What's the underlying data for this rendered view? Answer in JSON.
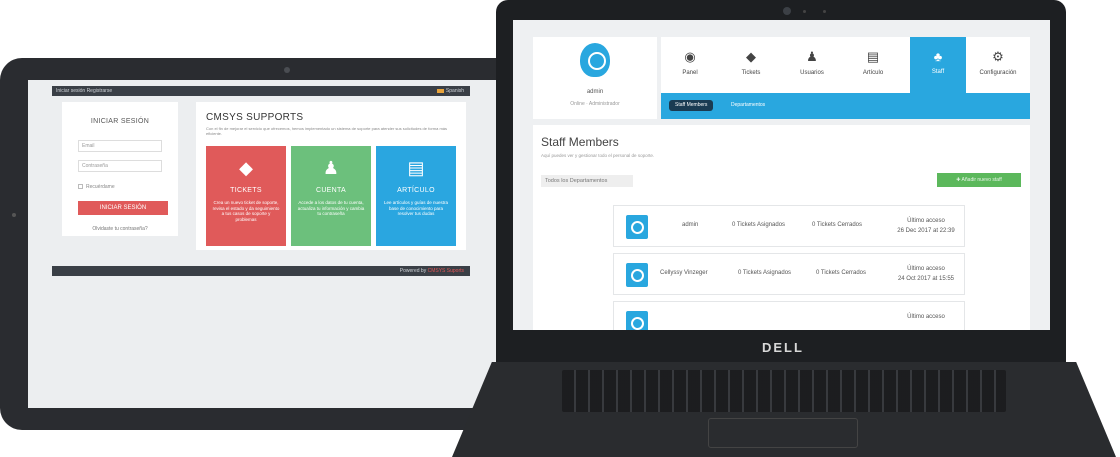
{
  "tablet": {
    "topbar": {
      "links": "Iniciar sesión   Registrarse",
      "language": "Spanish"
    },
    "login": {
      "title": "INICIAR SESIÓN",
      "email_placeholder": "Email",
      "password_placeholder": "Contraseña",
      "remember": "Recuérdame",
      "button": "INICIAR SESIÓN",
      "forgot": "Olvidaste tu contraseña?"
    },
    "main": {
      "title": "CMSYS SUPPORTS",
      "description": "Con el fin de mejorar el servicio que ofrecemos, hemos implementado un sistema de soporte para atender sus solicitudes de forma más eficiente.",
      "tiles": [
        {
          "title": "TICKETS",
          "text": "Crea un nuevo ticket de soporte, revisa el estado y da seguimiento a tus casos de soporte y problemas",
          "color": "#e05a5a"
        },
        {
          "title": "CUENTA",
          "text": "Accede a los datos de tu cuenta, actualiza tu información y cambia tu contraseña",
          "color": "#6cc07c"
        },
        {
          "title": "ARTÍCULO",
          "text": "Lee artículos y guías de nuestra base de conocimiento para resolver tus dudas",
          "color": "#2aa6e0"
        }
      ]
    },
    "footer": {
      "prefix": "Powered by ",
      "brand": "CMSYS Suports"
    }
  },
  "laptop": {
    "brand": "DELL",
    "profile": {
      "name": "admin",
      "status": "Online · Administrador"
    },
    "nav": [
      {
        "label": "Panel",
        "icon": "dashboard-icon",
        "glyph": "◉"
      },
      {
        "label": "Tickets",
        "icon": "ticket-icon",
        "glyph": "◆"
      },
      {
        "label": "Usuarios",
        "icon": "user-icon",
        "glyph": "♟"
      },
      {
        "label": "Artículo",
        "icon": "article-icon",
        "glyph": "▤"
      },
      {
        "label": "Staff",
        "icon": "staff-icon",
        "glyph": "♣"
      },
      {
        "label": "Configuración",
        "icon": "gear-icon",
        "glyph": "⚙"
      }
    ],
    "subtabs": [
      "Staff Members",
      "Departamentos"
    ],
    "panel": {
      "title": "Staff Members",
      "subtitle": "Aquí puedes ver y gestionar todo el personal de soporte.",
      "dept_button": "Todos los Departamentos",
      "add_button": "Añadir nuevo staff"
    },
    "staff": [
      {
        "name": "admin",
        "assigned": "0 Tickets Asignados",
        "closed": "0 Tickets Cerrados",
        "last_label": "Último acceso",
        "last_date": "26 Dec 2017 at 22:39"
      },
      {
        "name": "Cellyssy Vinzeger",
        "assigned": "0 Tickets Asignados",
        "closed": "0 Tickets Cerrados",
        "last_label": "Último acceso",
        "last_date": "24 Oct 2017 at 15:55"
      },
      {
        "name": "",
        "assigned": "",
        "closed": "",
        "last_label": "Último acceso",
        "last_date": ""
      }
    ]
  }
}
